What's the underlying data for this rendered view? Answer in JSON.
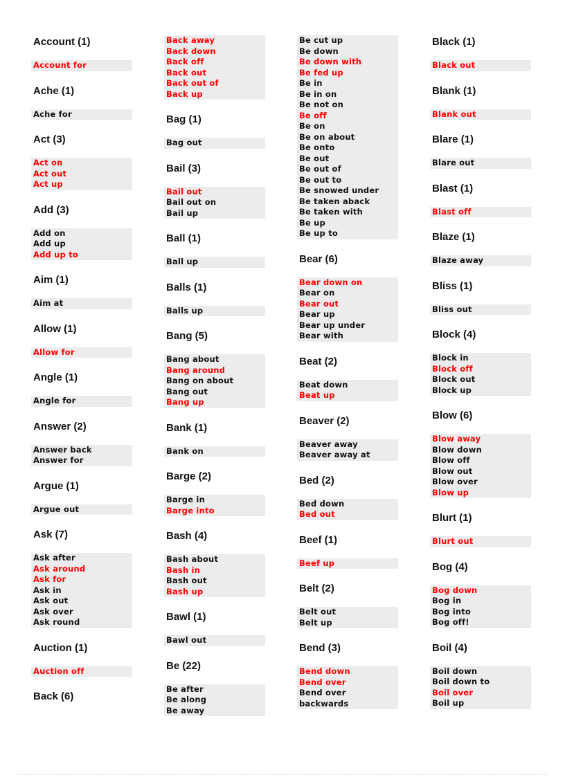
{
  "colors": {
    "highlight": "#ff0000",
    "normal": "#111111",
    "box_bg": "#ececec"
  },
  "columns": [
    [
      {
        "heading": "Account (1)",
        "items": [
          {
            "t": "Account for",
            "red": true
          }
        ]
      },
      {
        "heading": "Ache (1)",
        "items": [
          {
            "t": "Ache for",
            "red": false
          }
        ]
      },
      {
        "heading": "Act (3)",
        "items": [
          {
            "t": "Act on",
            "red": true
          },
          {
            "t": "Act out",
            "red": true
          },
          {
            "t": "Act up",
            "red": true
          }
        ]
      },
      {
        "heading": "Add (3)",
        "items": [
          {
            "t": "Add on",
            "red": false
          },
          {
            "t": "Add up",
            "red": false
          },
          {
            "t": "Add up to",
            "red": true
          }
        ]
      },
      {
        "heading": "Aim (1)",
        "items": [
          {
            "t": "Aim at",
            "red": false
          }
        ]
      },
      {
        "heading": "Allow (1)",
        "items": [
          {
            "t": "Allow for",
            "red": true
          }
        ]
      },
      {
        "heading": "Angle (1)",
        "items": [
          {
            "t": "Angle for",
            "red": false
          }
        ]
      },
      {
        "heading": "Answer (2)",
        "items": [
          {
            "t": "Answer back",
            "red": false
          },
          {
            "t": "Answer for",
            "red": false
          }
        ]
      },
      {
        "heading": "Argue (1)",
        "items": [
          {
            "t": "Argue out",
            "red": false
          }
        ]
      },
      {
        "heading": "Ask (7)",
        "items": [
          {
            "t": "Ask after",
            "red": false
          },
          {
            "t": "Ask around",
            "red": true
          },
          {
            "t": "Ask for",
            "red": true
          },
          {
            "t": "Ask in",
            "red": false
          },
          {
            "t": "Ask out",
            "red": false
          },
          {
            "t": "Ask over",
            "red": false
          },
          {
            "t": "Ask round",
            "red": false
          }
        ]
      },
      {
        "heading": "Auction (1)",
        "items": [
          {
            "t": "Auction off",
            "red": true
          }
        ]
      },
      {
        "heading": "Back (6)",
        "items": [],
        "gap": true
      }
    ],
    [
      {
        "items": [
          {
            "t": "Back away",
            "red": true
          },
          {
            "t": "Back down",
            "red": true
          },
          {
            "t": "Back off",
            "red": true
          },
          {
            "t": "Back out",
            "red": true
          },
          {
            "t": "Back out of",
            "red": true
          },
          {
            "t": "Back up",
            "red": true
          }
        ]
      },
      {
        "heading": "Bag (1)",
        "items": [
          {
            "t": "Bag out",
            "red": false
          }
        ]
      },
      {
        "heading": "Bail (3)",
        "items": [
          {
            "t": "Bail out",
            "red": true
          },
          {
            "t": "Bail out on",
            "red": false
          },
          {
            "t": "Bail up",
            "red": false
          }
        ]
      },
      {
        "heading": "Ball (1)",
        "items": [
          {
            "t": "Ball up",
            "red": false
          }
        ]
      },
      {
        "heading": "Balls (1)",
        "items": [
          {
            "t": "Balls up",
            "red": false
          }
        ]
      },
      {
        "heading": "Bang (5)",
        "items": [
          {
            "t": "Bang about",
            "red": false
          },
          {
            "t": "Bang around",
            "red": true
          },
          {
            "t": "Bang on about",
            "red": false
          },
          {
            "t": "Bang out",
            "red": false
          },
          {
            "t": "Bang up",
            "red": true
          }
        ]
      },
      {
        "heading": "Bank (1)",
        "items": [
          {
            "t": "Bank on",
            "red": false
          }
        ]
      },
      {
        "heading": "Barge (2)",
        "items": [
          {
            "t": "Barge in",
            "red": false
          },
          {
            "t": "Barge into",
            "red": true
          }
        ]
      },
      {
        "heading": "Bash (4)",
        "items": [
          {
            "t": "Bash about",
            "red": false
          },
          {
            "t": "Bash in",
            "red": true
          },
          {
            "t": "Bash out",
            "red": false
          },
          {
            "t": "Bash up",
            "red": true
          }
        ]
      },
      {
        "heading": "Bawl (1)",
        "items": [
          {
            "t": "Bawl out",
            "red": false
          }
        ]
      },
      {
        "heading": "Be (22)",
        "items": [
          {
            "t": "Be after",
            "red": false
          },
          {
            "t": "Be along",
            "red": false
          },
          {
            "t": "Be away",
            "red": false
          }
        ]
      }
    ],
    [
      {
        "items": [
          {
            "t": "Be cut up",
            "red": false
          },
          {
            "t": "Be down",
            "red": false
          },
          {
            "t": "Be down with",
            "red": true
          },
          {
            "t": "Be fed up",
            "red": true
          },
          {
            "t": "Be in",
            "red": false
          },
          {
            "t": "Be in on",
            "red": false
          },
          {
            "t": "Be not on",
            "red": false
          },
          {
            "t": "Be off",
            "red": true
          },
          {
            "t": "Be on",
            "red": false
          },
          {
            "t": "Be on about",
            "red": false
          },
          {
            "t": "Be onto",
            "red": false
          },
          {
            "t": "Be out",
            "red": false
          },
          {
            "t": "Be out of",
            "red": false
          },
          {
            "t": "Be out to",
            "red": false
          },
          {
            "t": "Be snowed under",
            "red": false
          },
          {
            "t": "Be taken aback",
            "red": false
          },
          {
            "t": "Be taken with",
            "red": false
          },
          {
            "t": "Be up",
            "red": false
          },
          {
            "t": "Be up to",
            "red": false
          }
        ]
      },
      {
        "heading": "Bear (6)",
        "items": [
          {
            "t": "Bear down on",
            "red": true
          },
          {
            "t": "Bear on",
            "red": false
          },
          {
            "t": "Bear out",
            "red": true
          },
          {
            "t": "Bear up",
            "red": false
          },
          {
            "t": "Bear up under",
            "red": false
          },
          {
            "t": "Bear with",
            "red": false
          }
        ]
      },
      {
        "heading": "Beat (2)",
        "items": [
          {
            "t": "Beat down",
            "red": false
          },
          {
            "t": "Beat up",
            "red": true
          }
        ]
      },
      {
        "heading": "Beaver (2)",
        "items": [
          {
            "t": "Beaver away",
            "red": false
          },
          {
            "t": "Beaver away at",
            "red": false
          }
        ]
      },
      {
        "heading": "Bed (2)",
        "items": [
          {
            "t": "Bed down",
            "red": false
          },
          {
            "t": "Bed out",
            "red": true
          }
        ]
      },
      {
        "heading": "Beef (1)",
        "items": [
          {
            "t": "Beef up",
            "red": true
          }
        ]
      },
      {
        "heading": "Belt (2)",
        "items": [
          {
            "t": "Belt out",
            "red": false
          },
          {
            "t": "Belt up",
            "red": false
          }
        ]
      },
      {
        "heading": "Bend (3)",
        "items": [
          {
            "t": "Bend down",
            "red": true
          },
          {
            "t": "Bend over",
            "red": true
          },
          {
            "t": "Bend over",
            "red": false
          },
          {
            "t": "backwards",
            "red": false
          }
        ]
      }
    ],
    [
      {
        "heading": "Black (1)",
        "items": [
          {
            "t": "Black out",
            "red": true
          }
        ]
      },
      {
        "heading": "Blank (1)",
        "items": [
          {
            "t": "Blank out",
            "red": true
          }
        ]
      },
      {
        "heading": "Blare (1)",
        "items": [
          {
            "t": "Blare out",
            "red": false
          }
        ]
      },
      {
        "heading": "Blast (1)",
        "items": [
          {
            "t": "Blast off",
            "red": true
          }
        ]
      },
      {
        "heading": "Blaze (1)",
        "items": [
          {
            "t": "Blaze away",
            "red": false
          }
        ]
      },
      {
        "heading": "Bliss (1)",
        "items": [
          {
            "t": "Bliss out",
            "red": false
          }
        ]
      },
      {
        "heading": "Block (4)",
        "items": [
          {
            "t": "Block in",
            "red": false
          },
          {
            "t": "Block off",
            "red": true
          },
          {
            "t": "Block out",
            "red": false
          },
          {
            "t": "Block up",
            "red": false
          }
        ]
      },
      {
        "heading": "Blow (6)",
        "items": [
          {
            "t": "Blow away",
            "red": true
          },
          {
            "t": "Blow down",
            "red": false
          },
          {
            "t": "Blow off",
            "red": false
          },
          {
            "t": "Blow out",
            "red": false
          },
          {
            "t": "Blow over",
            "red": false
          },
          {
            "t": "Blow up",
            "red": true
          }
        ]
      },
      {
        "heading": "Blurt (1)",
        "items": [
          {
            "t": "Blurt out",
            "red": true
          }
        ]
      },
      {
        "heading": "Bog (4)",
        "items": [
          {
            "t": "Bog down",
            "red": true
          },
          {
            "t": "Bog in",
            "red": false
          },
          {
            "t": "Bog into",
            "red": false
          },
          {
            "t": "Bog off!",
            "red": false
          }
        ]
      },
      {
        "heading": "Boil (4)",
        "items": [
          {
            "t": "Boil down",
            "red": false
          },
          {
            "t": "Boil down to",
            "red": false
          },
          {
            "t": "Boil over",
            "red": true
          },
          {
            "t": "Boil up",
            "red": false
          }
        ]
      }
    ]
  ]
}
